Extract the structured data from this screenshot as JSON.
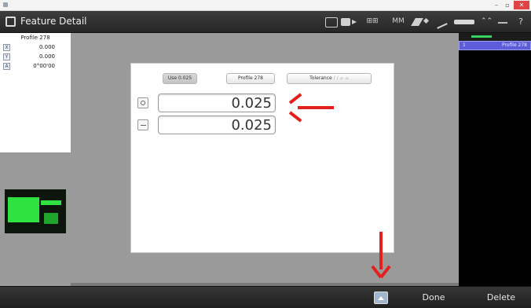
{
  "app": {
    "title": "Feature Detail"
  },
  "toolbar": {
    "icons": [
      "home-icon",
      "camera-icon",
      "grid-icon",
      "units-icon",
      "probe-icon",
      "wand-icon",
      "slider-icon",
      "collapse-icon",
      "minimize-icon",
      "help-icon"
    ],
    "units_label": "MM",
    "help_label": "?"
  },
  "left_panel": {
    "feature_name": "Profile 278",
    "rows": [
      {
        "axis": "X",
        "value": "0.000"
      },
      {
        "axis": "Y",
        "value": "0.000"
      },
      {
        "axis": "A",
        "value": "0°00'00"
      }
    ]
  },
  "dialog": {
    "tabs": [
      {
        "label": "Use 0.025"
      },
      {
        "label": "Profile 278"
      },
      {
        "label": "Tolerance"
      }
    ],
    "tolerance_symbols": "/ / ⌓ ⌓",
    "fields": [
      {
        "name": "upper-tolerance",
        "value": "0.025"
      },
      {
        "name": "lower-tolerance",
        "value": "0.025"
      }
    ]
  },
  "right_panel": {
    "items": [
      {
        "index": "1",
        "label": "Profile 278"
      }
    ]
  },
  "bottom_bar": {
    "done_label": "Done",
    "delete_label": "Delete"
  },
  "colors": {
    "annotation_arrow": "#e3201b",
    "selection": "#5d5dd9",
    "preview_green": "#2fe23f"
  }
}
